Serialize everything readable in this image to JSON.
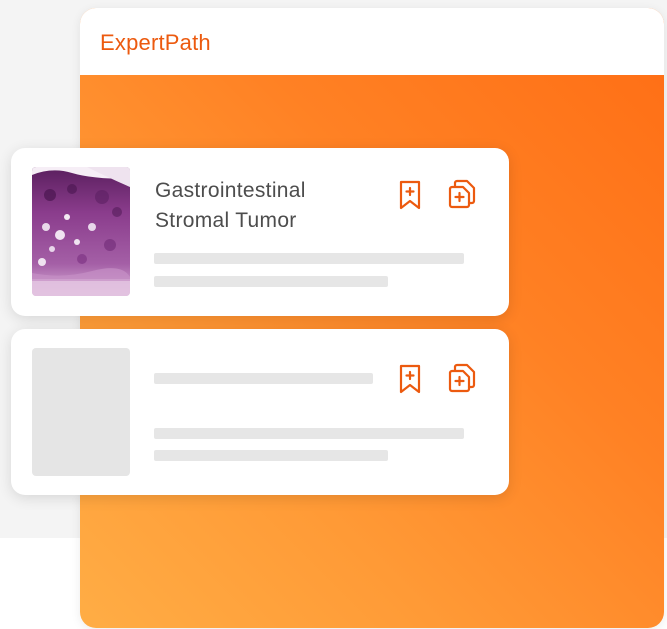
{
  "app": {
    "brand_name": "ExpertPath",
    "brand_color": "#ec5a0f",
    "accent_gradient": [
      "#ff6d14",
      "#ffad45"
    ]
  },
  "cards": [
    {
      "title": "Gastrointestinal Stromal Tumor",
      "thumbnail": "histology-slide",
      "icons": [
        "bookmark-plus-icon",
        "copy-add-icon"
      ]
    },
    {
      "title": "",
      "thumbnail": "placeholder",
      "icons": [
        "bookmark-plus-icon",
        "copy-add-icon"
      ]
    }
  ]
}
